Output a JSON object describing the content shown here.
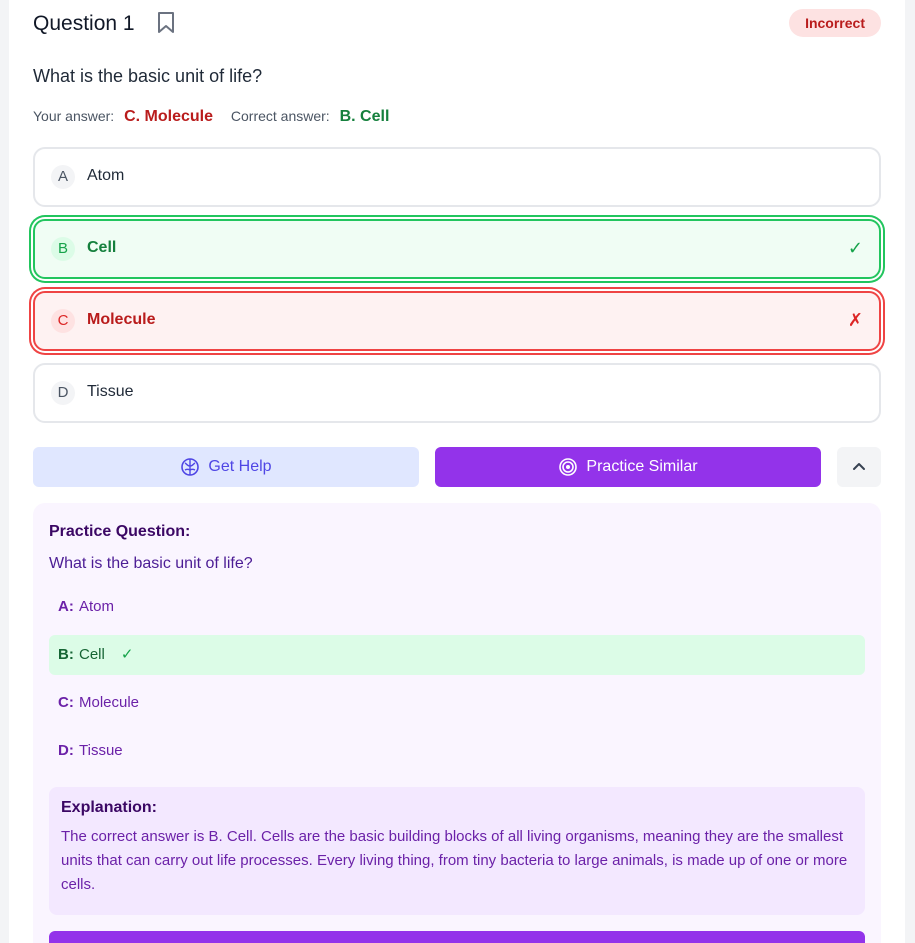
{
  "question": {
    "title": "Question 1",
    "status": "Incorrect",
    "text": "What is the basic unit of life?",
    "your_answer_label": "Your answer:",
    "your_answer_value": "C. Molecule",
    "correct_answer_label": "Correct answer:",
    "correct_answer_value": "B. Cell",
    "options": [
      {
        "letter": "A",
        "label": "Atom",
        "state": "neutral",
        "mark": ""
      },
      {
        "letter": "B",
        "label": "Cell",
        "state": "correct",
        "mark": "✓"
      },
      {
        "letter": "C",
        "label": "Molecule",
        "state": "wrong",
        "mark": "✗"
      },
      {
        "letter": "D",
        "label": "Tissue",
        "state": "neutral",
        "mark": ""
      }
    ]
  },
  "actions": {
    "get_help": "Get Help",
    "practice_similar": "Practice Similar"
  },
  "practice": {
    "title": "Practice Question:",
    "text": "What is the basic unit of life?",
    "options": [
      {
        "letter": "A:",
        "label": "Atom",
        "mark": ""
      },
      {
        "letter": "B:",
        "label": "Cell",
        "mark": "✓"
      },
      {
        "letter": "C:",
        "label": "Molecule",
        "mark": ""
      },
      {
        "letter": "D:",
        "label": "Tissue",
        "mark": ""
      }
    ],
    "explanation_title": "Explanation:",
    "explanation_text": "The correct answer is B. Cell. Cells are the basic building blocks of all living organisms, meaning they are the smallest units that can carry out life processes. Every living thing, from tiny bacteria to large animals, is made up of one or more cells."
  },
  "colors": {
    "accent": "#9333ea",
    "correct": "#16a34a",
    "incorrect": "#dc2626"
  }
}
